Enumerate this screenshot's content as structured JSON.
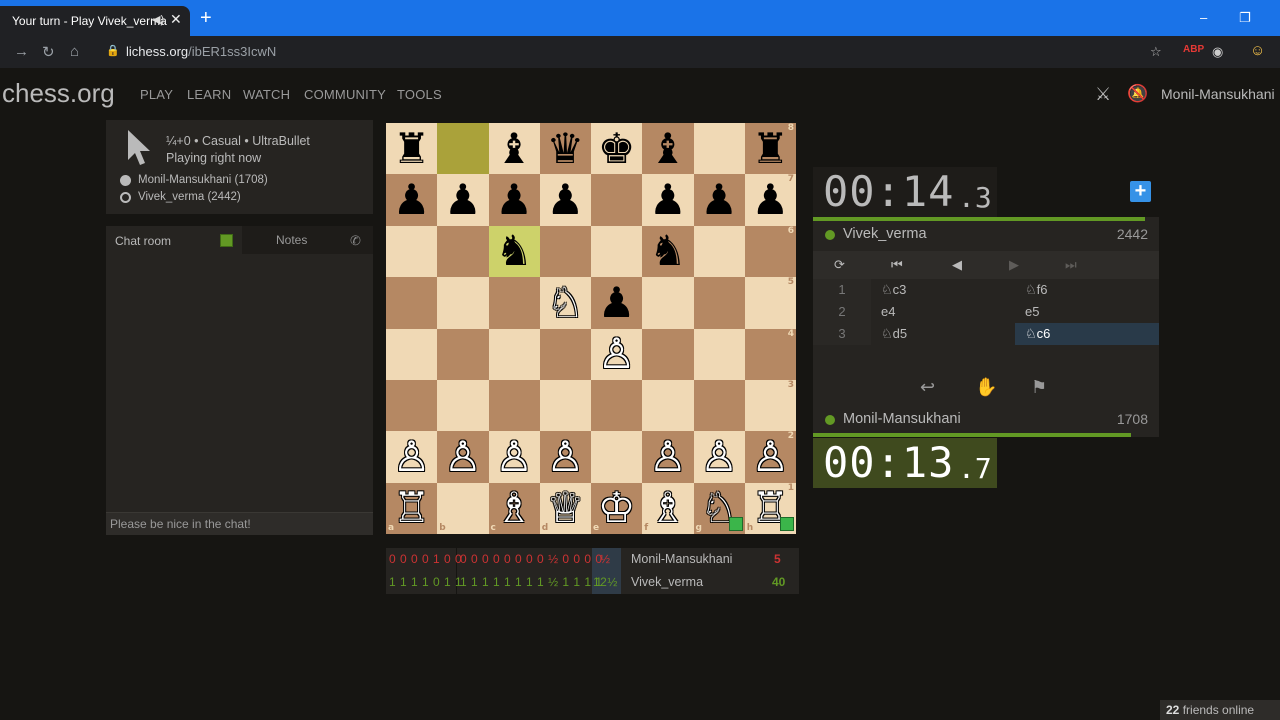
{
  "browser": {
    "tab_title": "Your turn - Play Vivek_verma",
    "tab_audio_icon": "speaker-icon",
    "new_tab": "+",
    "url_host": "lichess.org",
    "url_path": "/ibER1ss3IcwN",
    "window_controls": [
      "–",
      "❐"
    ]
  },
  "site": {
    "logo": "chess.org",
    "nav": [
      "PLAY",
      "LEARN",
      "WATCH",
      "COMMUNITY",
      "TOOLS"
    ],
    "username": "Monil-Mansukhani"
  },
  "game": {
    "title": "¼+0 • Casual • UltraBullet",
    "status": "Playing right now",
    "players": [
      {
        "label": "Monil-Mansukhani (1708)",
        "color": "white"
      },
      {
        "label": "Vivek_verma (2442)",
        "color": "black"
      }
    ]
  },
  "chat": {
    "tab_room": "Chat room",
    "tab_notes": "Notes",
    "placeholder": "Please be nice in the chat!"
  },
  "board": {
    "ranks": [
      [
        "♜",
        "",
        "♝",
        "♛",
        "♚",
        "♝",
        "",
        "♜"
      ],
      [
        "♟",
        "♟",
        "♟",
        "♟",
        "",
        "♟",
        "♟",
        "♟"
      ],
      [
        "",
        "",
        "♞",
        "",
        "",
        "♞",
        "",
        ""
      ],
      [
        "",
        "",
        "",
        "♘",
        "♟",
        "",
        "",
        ""
      ],
      [
        "",
        "",
        "",
        "",
        "♙",
        "",
        "",
        ""
      ],
      [
        "",
        "",
        "",
        "",
        "",
        "",
        "",
        ""
      ],
      [
        "♙",
        "♙",
        "♙",
        "♙",
        "",
        "♙",
        "♙",
        "♙"
      ],
      [
        "♖",
        "",
        "♗",
        "♕",
        "♔",
        "♗",
        "♘",
        "♖"
      ]
    ],
    "colors": [
      [
        "b",
        "",
        "b",
        "b",
        "b",
        "b",
        "",
        "b"
      ],
      [
        "b",
        "b",
        "b",
        "b",
        "",
        "b",
        "b",
        "b"
      ],
      [
        "",
        "",
        "b",
        "",
        "",
        "b",
        "",
        ""
      ],
      [
        "",
        "",
        "",
        "w",
        "b",
        "",
        "",
        ""
      ],
      [
        "",
        "",
        "",
        "",
        "w",
        "",
        "",
        ""
      ],
      [
        "",
        "",
        "",
        "",
        "",
        "",
        "",
        ""
      ],
      [
        "w",
        "w",
        "w",
        "w",
        "",
        "w",
        "w",
        "w"
      ],
      [
        "w",
        "",
        "w",
        "w",
        "w",
        "w",
        "w",
        "w"
      ]
    ],
    "last_move_from": [
      0,
      1
    ],
    "last_move_to": [
      2,
      2
    ],
    "premove_squares": [
      [
        7,
        6
      ],
      [
        7,
        7
      ]
    ],
    "rank_labels": [
      "8",
      "7",
      "6",
      "5",
      "4",
      "3",
      "2",
      "1"
    ],
    "file_labels": [
      "a",
      "b",
      "c",
      "d",
      "e",
      "f",
      "g",
      "h"
    ]
  },
  "crosstable": {
    "rows": [
      {
        "seg1": "0 0 0 0 1 0 0",
        "seg2": "0 0 0 0 0 0 0 0 ½ 0 0 0 0",
        "half": "½",
        "name": "Monil-Mansukhani",
        "score": "5",
        "cls": "loss"
      },
      {
        "seg1": "1 1 1 1 0 1 1",
        "seg2": "1 1 1 1 1 1 1 1 ½ 1 1 1 1",
        "half": "12½",
        "name": "Vivek_verma",
        "score": "40",
        "cls": "win"
      }
    ]
  },
  "clocks": {
    "top": {
      "digits": "00:14",
      "tenths": ".3"
    },
    "bottom": {
      "digits": "00:13",
      "tenths": ".7"
    }
  },
  "players_panel": {
    "top": {
      "name": "Vivek_verma",
      "rating": "2442",
      "bar_fraction": 0.96
    },
    "bottom": {
      "name": "Monil-Mansukhani",
      "rating": "1708",
      "bar_fraction": 0.92
    }
  },
  "move_controls": [
    "⟳",
    "⏮",
    "◀",
    "▶",
    "⏭"
  ],
  "moves": [
    {
      "n": "1",
      "w": "♘c3",
      "b": "♘f6"
    },
    {
      "n": "2",
      "w": "e4",
      "b": "e5"
    },
    {
      "n": "3",
      "w": "♘d5",
      "b": "♘c6"
    }
  ],
  "actions": [
    "↩",
    "✋",
    "⚑"
  ],
  "friends": {
    "count": "22",
    "label": "friends online"
  }
}
